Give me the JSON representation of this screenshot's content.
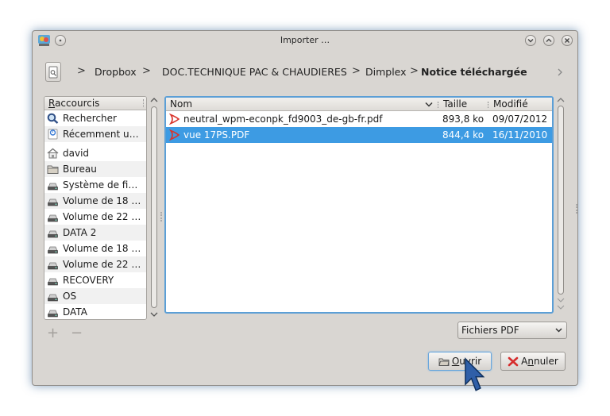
{
  "window": {
    "title": "Importer …",
    "app_icon": "kde-app-icon"
  },
  "breadcrumb": {
    "items": [
      "Dropbox",
      "DOC.TECHNIQUE PAC & CHAUDIERES",
      "Dimplex"
    ],
    "current": "Notice téléchargée",
    "separator": ">"
  },
  "places": {
    "header_first": "R",
    "header_rest": "accourcis",
    "items": [
      {
        "label": "Rechercher",
        "icon": "search-icon"
      },
      {
        "label": "Récemment u…",
        "icon": "recent-icon"
      },
      {
        "label": "david",
        "icon": "home-icon"
      },
      {
        "label": "Bureau",
        "icon": "folder-icon"
      },
      {
        "label": "Système de fi…",
        "icon": "drive-icon"
      },
      {
        "label": "Volume de 18 …",
        "icon": "drive-icon"
      },
      {
        "label": "Volume de 22 …",
        "icon": "drive-icon"
      },
      {
        "label": "DATA 2",
        "icon": "drive-icon"
      },
      {
        "label": "Volume de 18 …",
        "icon": "drive-icon"
      },
      {
        "label": "Volume de 22 …",
        "icon": "drive-icon"
      },
      {
        "label": "RECOVERY",
        "icon": "drive-icon"
      },
      {
        "label": "OS",
        "icon": "drive-icon"
      },
      {
        "label": "DATA",
        "icon": "drive-icon"
      }
    ],
    "add_label": "+",
    "remove_label": "−"
  },
  "files": {
    "columns": {
      "name": "Nom",
      "size": "Taille",
      "modified": "Modifié"
    },
    "rows": [
      {
        "name": "neutral_wpm-econpk_fd9003_de-gb-fr.pdf",
        "size": "893,8 ko",
        "modified": "09/07/2012",
        "selected": false
      },
      {
        "name": "vue 17PS.PDF",
        "size": "844,4 ko",
        "modified": "16/11/2010",
        "selected": true
      }
    ]
  },
  "filter": {
    "selected": "Fichiers PDF"
  },
  "buttons": {
    "open_mnemonic": "O",
    "open_rest": "uvrir",
    "cancel_pre": "A",
    "cancel_mnemonic": "n",
    "cancel_rest": "nuler"
  },
  "colors": {
    "selection": "#3d9be3",
    "focus_border": "#5c9fd6",
    "pdf_icon": "#d9342b"
  }
}
